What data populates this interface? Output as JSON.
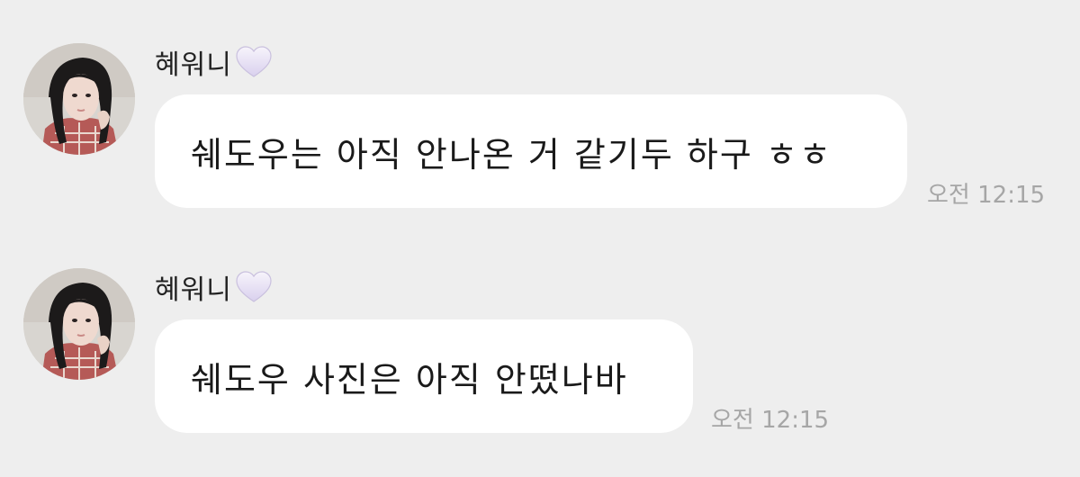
{
  "messages": [
    {
      "sender": "혜워니",
      "sender_icon": "white-heart-icon",
      "text": "쉐도우는 아직 안나온 거 같기두 하구 ㅎㅎ",
      "time": "오전 12:15"
    },
    {
      "sender": "혜워니",
      "sender_icon": "white-heart-icon",
      "text": "쉐도우 사진은 아직 안떴나바",
      "time": "오전 12:15"
    }
  ],
  "colors": {
    "background": "#eeeeee",
    "bubble": "#ffffff",
    "timestamp": "#a6a6a6",
    "heart": "#e9e3f5"
  }
}
